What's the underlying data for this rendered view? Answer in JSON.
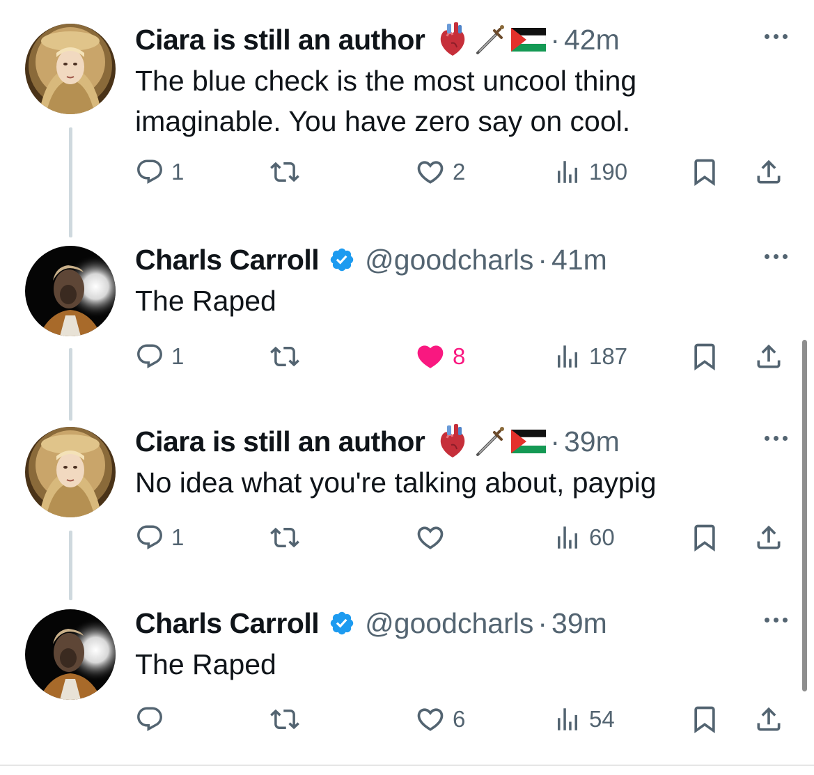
{
  "tweets": [
    {
      "name": "Ciara is still an author",
      "emojis": [
        "anatomical-heart",
        "dagger",
        "palestine-flag"
      ],
      "verified": false,
      "handle": "",
      "time": "42m",
      "text": "The blue check is the most uncool thing imaginable. You have zero say on cool.",
      "avatar": "madonna-statue",
      "replies": "1",
      "retweets": "",
      "likes": "2",
      "liked": false,
      "views": "190"
    },
    {
      "name": "Charls Carroll",
      "emojis": [],
      "verified": true,
      "handle": "@goodcharls",
      "time": "41m",
      "text": "The Raped",
      "avatar": "man-dark-photo",
      "replies": "1",
      "retweets": "",
      "likes": "8",
      "liked": true,
      "views": "187"
    },
    {
      "name": "Ciara is still an author",
      "emojis": [
        "anatomical-heart",
        "dagger",
        "palestine-flag"
      ],
      "verified": false,
      "handle": "",
      "time": "39m",
      "text": "No idea what you're talking about, paypig",
      "avatar": "madonna-statue",
      "replies": "1",
      "retweets": "",
      "likes": "",
      "liked": false,
      "views": "60"
    },
    {
      "name": "Charls Carroll",
      "emojis": [],
      "verified": true,
      "handle": "@goodcharls",
      "time": "39m",
      "text": "The Raped",
      "avatar": "man-dark-photo",
      "replies": "",
      "retweets": "",
      "likes": "6",
      "liked": false,
      "views": "54"
    }
  ],
  "separator": "·",
  "colors": {
    "text": "#0f1419",
    "secondary": "#536471",
    "like_active": "#f91880",
    "verified_blue": "#1d9bf0",
    "thread_line": "#cfd9de"
  }
}
